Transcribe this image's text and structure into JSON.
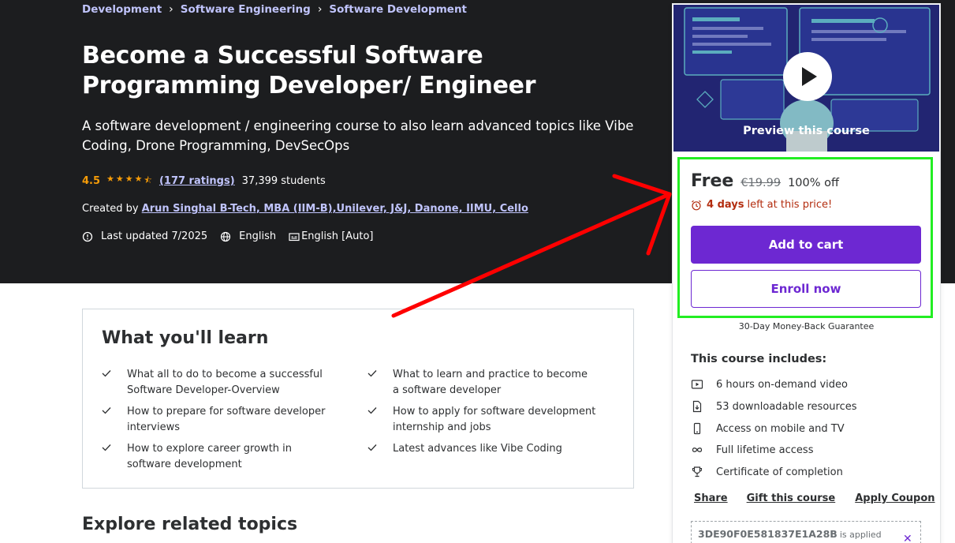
{
  "breadcrumb": [
    "Development",
    "Software Engineering",
    "Software Development"
  ],
  "course": {
    "title": "Become a Successful Software Programming Developer/ Engineer",
    "subtitle": "A software development / engineering course to also learn advanced topics like Vibe Coding, Drone Programming, DevSecOps",
    "rating": "4.5",
    "rating_stars": 4.5,
    "ratings_count": "(177 ratings)",
    "students": "37,399 students",
    "created_by_label": "Created by",
    "author": "Arun Singhal B-Tech, MBA (IIM-B),Unilever, J&J, Danone, IIMU, Cello",
    "last_updated": "Last updated 7/2025",
    "language": "English",
    "captions": "English [Auto]"
  },
  "learn": {
    "title": "What you'll learn",
    "items": [
      "What all to do to become a successful Software Developer-Overview",
      "What to learn and practice to become a software developer",
      "How to prepare for software developer interviews",
      "How to apply for software development internship and jobs",
      "How to explore career growth in software development",
      "Latest advances like Vibe Coding"
    ]
  },
  "explore_title": "Explore related topics",
  "sidebar": {
    "preview_label": "Preview this course",
    "price": "Free",
    "original_price": "€19.99",
    "discount": "100% off",
    "timer_days": "4 days",
    "timer_rest": "left at this price!",
    "add_to_cart": "Add to cart",
    "enroll_now": "Enroll now",
    "guarantee": "30-Day Money-Back Guarantee",
    "includes_title": "This course includes:",
    "includes": [
      {
        "icon": "video-icon",
        "label": "6 hours on-demand video"
      },
      {
        "icon": "file-download-icon",
        "label": "53 downloadable resources"
      },
      {
        "icon": "mobile-icon",
        "label": "Access on mobile and TV"
      },
      {
        "icon": "infinity-icon",
        "label": "Full lifetime access"
      },
      {
        "icon": "trophy-icon",
        "label": "Certificate of completion"
      }
    ],
    "actions": [
      "Share",
      "Gift this course",
      "Apply Coupon"
    ],
    "coupon_code": "3DE90F0E581837E1A28B",
    "coupon_status": "is applied"
  },
  "colors": {
    "hero_bg": "#1c1d1f",
    "accent": "#6d28d2",
    "link": "#c0c4fc",
    "star": "#f69c08",
    "timer": "#b32d0f",
    "highlight": "#22ee22",
    "annotation_arrow": "#ff0000"
  }
}
